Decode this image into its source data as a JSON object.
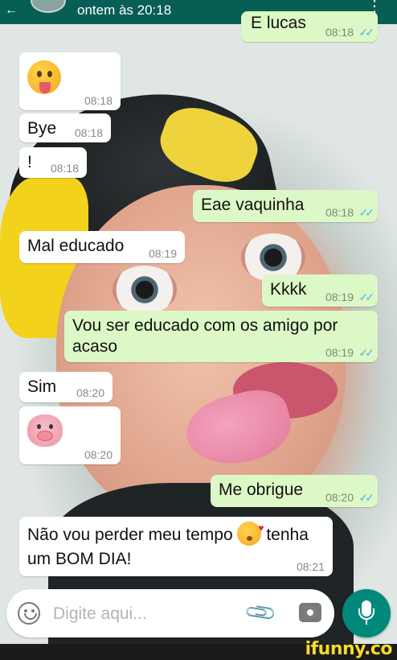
{
  "header": {
    "last_seen": "ontem às 20:18",
    "back_icon": "arrow-left-icon",
    "menu_icon": "more-vertical-icon"
  },
  "messages": [
    {
      "dir": "out",
      "text": "E lucas",
      "time": "08:18",
      "status": "read"
    },
    {
      "dir": "in",
      "emoji": "face-with-tongue",
      "text": "",
      "time": "08:18"
    },
    {
      "dir": "in",
      "text": "Bye",
      "time": "08:18"
    },
    {
      "dir": "in",
      "text": "!",
      "time": "08:18"
    },
    {
      "dir": "out",
      "text": "Eae vaquinha",
      "time": "08:18",
      "status": "read"
    },
    {
      "dir": "in",
      "text": "Mal educado",
      "time": "08:19"
    },
    {
      "dir": "out",
      "text": "Kkkk",
      "time": "08:19",
      "status": "read"
    },
    {
      "dir": "out",
      "text": "Vou ser educado com os amigo por acaso",
      "time": "08:19",
      "status": "read"
    },
    {
      "dir": "in",
      "text": "Sim",
      "time": "08:20"
    },
    {
      "dir": "in",
      "emoji": "pig-face",
      "text": "",
      "time": "08:20"
    },
    {
      "dir": "out",
      "text": "Me obrigue",
      "time": "08:20",
      "status": "read"
    },
    {
      "dir": "in",
      "text_before": "Não vou perder meu tempo",
      "emoji": "face-blowing-kiss",
      "text_after": "tenha um BOM DIA!",
      "time": "08:21"
    }
  ],
  "composer": {
    "placeholder": "Digite aqui...",
    "emoji_icon": "smiley-icon",
    "attach_icon": "paperclip-icon",
    "camera_icon": "camera-icon",
    "send_icon": "microphone-icon"
  },
  "watermark": "ifunny.co",
  "colors": {
    "header": "#075e54",
    "incoming_bubble": "#ffffff",
    "outgoing_bubble": "#dcf8c6",
    "read_ticks": "#4fb6ec",
    "mic_button": "#00897b",
    "watermark": "#f7d92a"
  }
}
